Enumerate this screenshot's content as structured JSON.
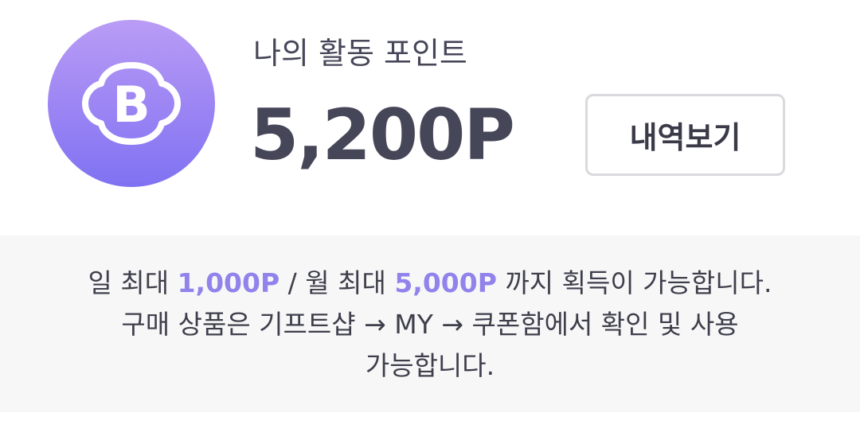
{
  "header": {
    "title": "나의 활동 포인트",
    "points": "5,200P",
    "history_button": "내역보기",
    "badge_letter": "B",
    "badge_icon": "point-b-icon"
  },
  "info": {
    "line1_a": "일 최대 ",
    "daily_max": "1,000P",
    "line1_b": " / 월 최대 ",
    "monthly_max": "5,000P",
    "line1_c": " 까지 획득이 가능합니다.",
    "line2": "구매 상품은 기프트샵 → MY → 쿠폰함에서 확인 및 사용",
    "line3": "가능합니다."
  },
  "colors": {
    "accent": "#9183ec",
    "text": "#464659",
    "info_bg": "#f7f7f8"
  }
}
